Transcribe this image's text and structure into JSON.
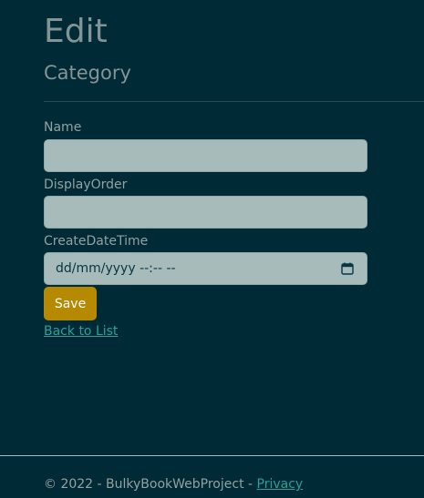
{
  "page": {
    "title": "Edit",
    "subtitle": "Category"
  },
  "form": {
    "name_label": "Name",
    "name_value": "",
    "display_order_label": "DisplayOrder",
    "display_order_value": "",
    "create_date_label": "CreateDateTime",
    "create_date_placeholder": "dd/mm/yyyy --:-- --",
    "save_label": "Save",
    "back_link_label": "Back to List"
  },
  "footer": {
    "copyright": "© 2022 - BulkyBookWebProject - ",
    "privacy_link": "Privacy"
  },
  "icons": {
    "calendar": "calendar-icon"
  },
  "colors": {
    "background": "#002b36",
    "input_background": "#a7bcba",
    "save_button": "#b58900",
    "link": "#2aa198"
  }
}
